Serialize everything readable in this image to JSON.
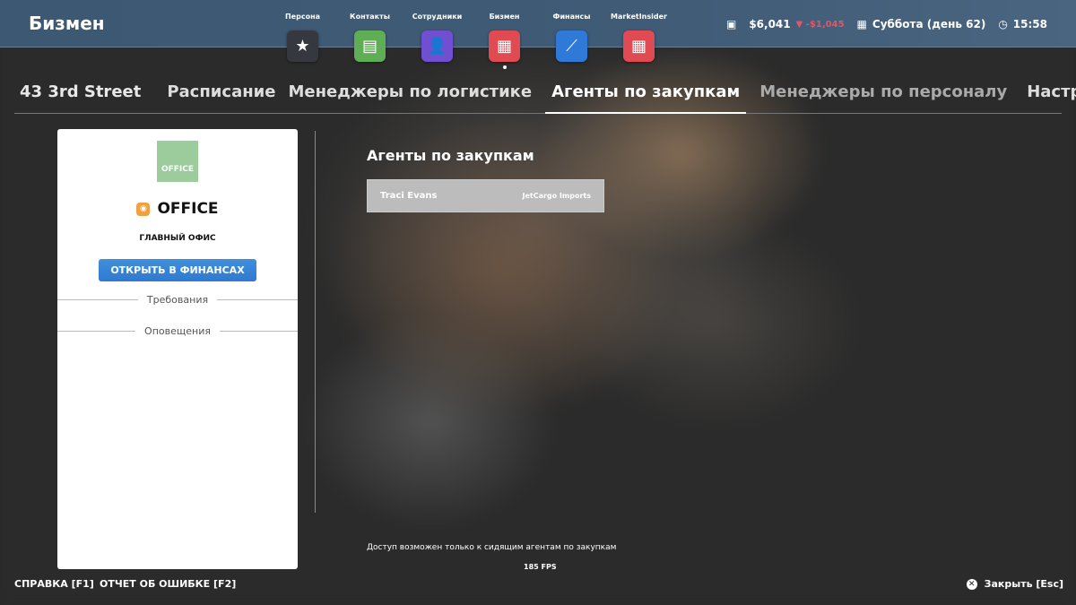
{
  "header": {
    "brand": "Бизмен",
    "apps": [
      {
        "label": "Персона",
        "icon": "star-icon",
        "glyph": "★",
        "color": "#35393f"
      },
      {
        "label": "Контакты",
        "icon": "chat-icon",
        "glyph": "▤",
        "color": "#5fae55"
      },
      {
        "label": "Сотрудники",
        "icon": "badge-icon",
        "glyph": "👤",
        "color": "#7050d0"
      },
      {
        "label": "Бизмен",
        "icon": "store-icon",
        "glyph": "▦",
        "color": "#e04a52"
      },
      {
        "label": "Финансы",
        "icon": "chart-sparkle-icon",
        "glyph": "⟋",
        "color": "#2f7ad8"
      },
      {
        "label": "MarketInsider",
        "icon": "store-icon",
        "glyph": "▦",
        "color": "#e04a52"
      }
    ],
    "money": "$6,041",
    "money_change": "▼ -$1,045",
    "date": "Суббота (день 62)",
    "time": "15:58"
  },
  "tabs": [
    "43 3rd Street",
    "Расписание",
    "Менеджеры по логистике",
    "Агенты по закупкам",
    "Менеджеры по персоналу",
    "Настройки"
  ],
  "card": {
    "thumb_label": "OFFICE",
    "title": "OFFICE",
    "subtitle": "ГЛАВНЫЙ ОФИС",
    "button": "ОТКРЫТЬ В ФИНАНСАХ",
    "sections": [
      "Требования",
      "Оповещения"
    ]
  },
  "main": {
    "heading": "Агенты по закупкам",
    "agents": [
      {
        "name": "Traci Evans",
        "company": "JetCargo Imports"
      }
    ],
    "note": "Доступ возможен только к сидящим агентам по закупкам",
    "fps": "185 FPS"
  },
  "footer": {
    "help": "СПРАВКА [F1]",
    "bug": "ОТЧЕТ ОБ ОШИБКЕ [F2]",
    "close": "Закрыть [Esc]"
  }
}
